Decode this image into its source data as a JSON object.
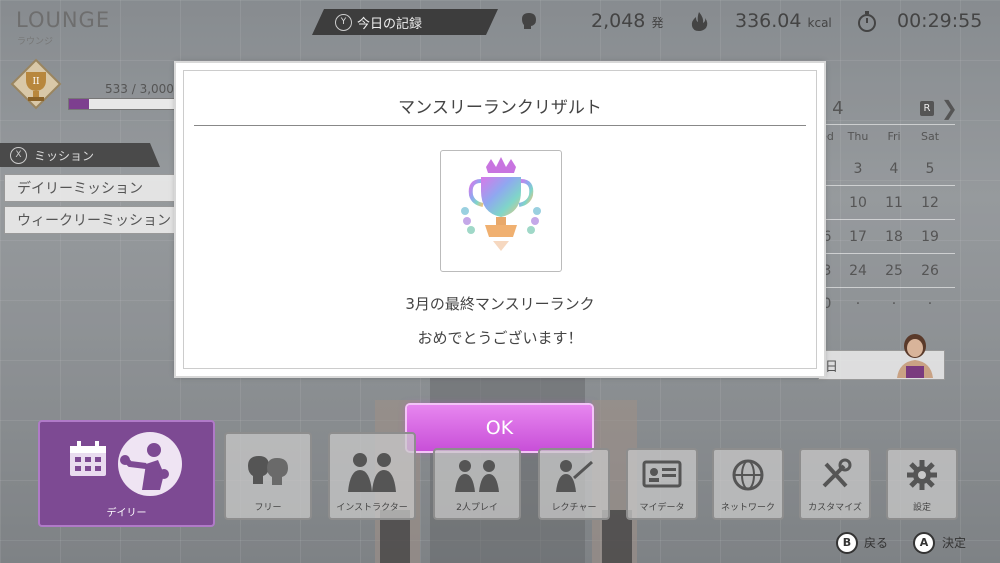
{
  "lounge": {
    "title": "LOUNGE",
    "subtitle": "ラウンジ",
    "rank_numeral": "II",
    "rank_progress_text": "533 / 3,000",
    "rank_progress": 0.178
  },
  "mission": {
    "button": "X",
    "label": "ミッション",
    "items": [
      "デイリーミッション",
      "ウィークリーミッション"
    ]
  },
  "record": {
    "button": "Y",
    "label": "今日の記録"
  },
  "stats": {
    "punches": {
      "icon": "boxing-glove-icon",
      "value": "2,048",
      "unit": "発"
    },
    "calories": {
      "icon": "flame-icon",
      "value": "336.04",
      "unit": "kcal"
    },
    "time": {
      "icon": "stopwatch-icon",
      "value": "00:29:55"
    }
  },
  "calendar": {
    "month_fragment": "5 4",
    "r_button": "R",
    "next_arrow": "❯",
    "weekdays": [
      "ed",
      "Thu",
      "Fri",
      "Sat"
    ],
    "rows": [
      [
        "",
        "3",
        "4",
        "5"
      ],
      [
        "",
        "10",
        "11",
        "12"
      ],
      [
        "6",
        "17",
        "18",
        "19"
      ],
      [
        "3",
        "24",
        "25",
        "26"
      ],
      [
        "0",
        "·",
        "·",
        "·"
      ]
    ],
    "box_fragment": "日"
  },
  "dialog": {
    "title": "マンスリーランクリザルト",
    "line1": "3月の最終マンスリーランク",
    "line2": "おめでとうございます！",
    "ok": "OK"
  },
  "menu": {
    "daily": "デイリー",
    "tiles": [
      {
        "label": "フリー",
        "icon": "boxing-gloves-icon"
      },
      {
        "label": "インストラクター",
        "icon": "instructors-icon"
      },
      {
        "label": "2人プレイ",
        "icon": "two-player-icon"
      },
      {
        "label": "レクチャー",
        "icon": "lecture-icon"
      },
      {
        "label": "マイデータ",
        "icon": "id-card-icon"
      },
      {
        "label": "ネットワーク",
        "icon": "globe-icon"
      },
      {
        "label": "カスタマイズ",
        "icon": "tools-icon"
      },
      {
        "label": "設定",
        "icon": "gear-icon"
      }
    ]
  },
  "hints": {
    "b_button": "B",
    "b_label": "戻る",
    "a_button": "A",
    "a_label": "決定"
  },
  "colors": {
    "accent": "#c84fd8",
    "daily": "#7d4a93",
    "rank_fill": "#7d3f8f"
  }
}
